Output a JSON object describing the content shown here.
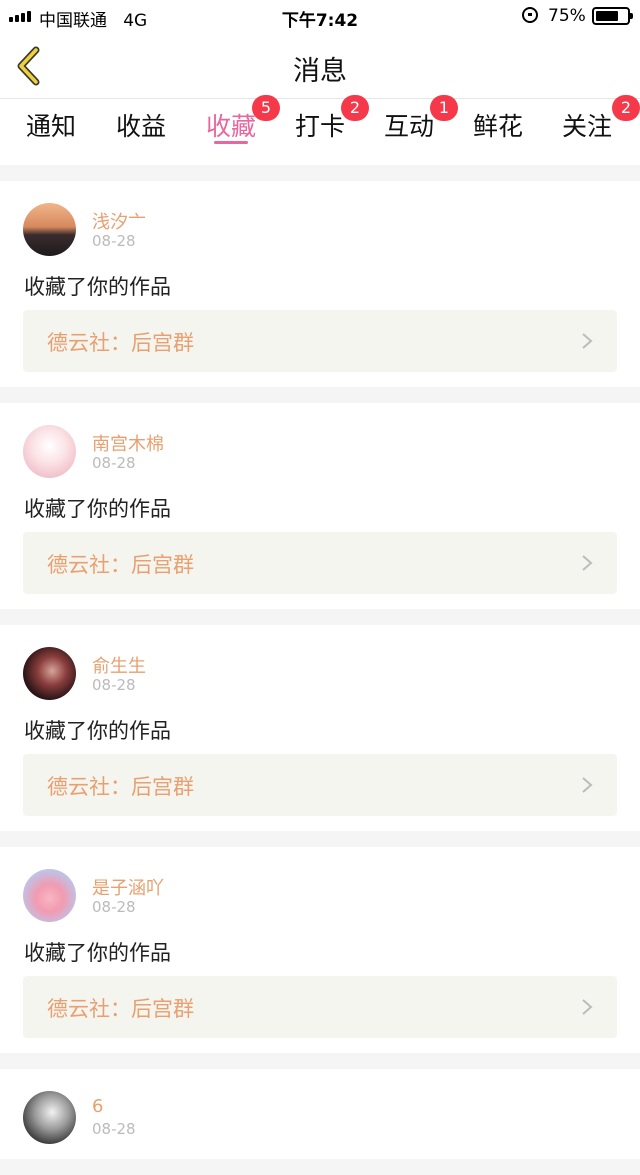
{
  "status_bar": {
    "carrier": "中国联通",
    "network": "4G",
    "time": "下午7:42",
    "battery": "75%",
    "battery_level": 0.75
  },
  "nav": {
    "title": "消息"
  },
  "tabs": [
    {
      "label": "通知",
      "badge": ""
    },
    {
      "label": "收益",
      "badge": ""
    },
    {
      "label": "收藏",
      "badge": "5",
      "active": true
    },
    {
      "label": "打卡",
      "badge": "2"
    },
    {
      "label": "互动",
      "badge": "1"
    },
    {
      "label": "鲜花",
      "badge": ""
    },
    {
      "label": "关注",
      "badge": "2"
    }
  ],
  "items": [
    {
      "user": "浅汐亠",
      "date": "08-28",
      "action": "收藏了你的作品",
      "ref": "德云社：后宫群",
      "avatar": "avatar-sunset-girl"
    },
    {
      "user": "南宫木棉",
      "date": "08-28",
      "action": "收藏了你的作品",
      "ref": "德云社：后宫群",
      "avatar": "avatar-anime-girl"
    },
    {
      "user": "俞生生",
      "date": "08-28",
      "action": "收藏了你的作品",
      "ref": "德云社：后宫群",
      "avatar": "avatar-dark-girl"
    },
    {
      "user": "是子涵吖",
      "date": "08-28",
      "action": "收藏了你的作品",
      "ref": "德云社：后宫群",
      "avatar": "avatar-pink-hand"
    },
    {
      "user": "6",
      "date": "08-28",
      "avatar": "avatar-bw-portrait"
    }
  ],
  "colors": {
    "accent": "#e6689e",
    "badge": "#f5394a",
    "username": "#e8a070",
    "ref_bg": "#f5f5ef",
    "back_arrow": "#f0d040"
  }
}
